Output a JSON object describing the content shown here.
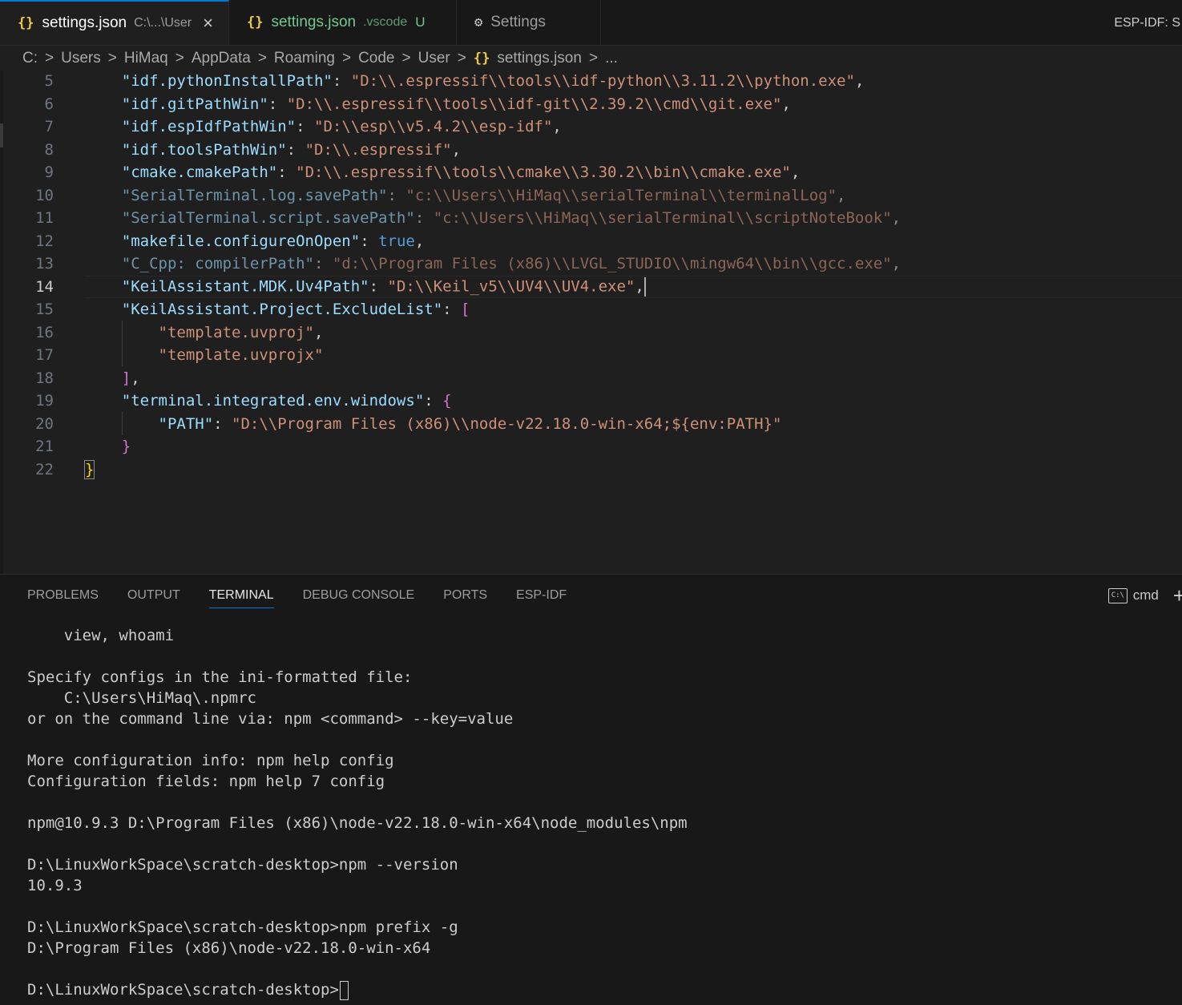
{
  "tabs": [
    {
      "icon": "{}",
      "name": "settings.json",
      "description": "C:\\...\\User",
      "close": "×",
      "badge": ""
    },
    {
      "icon": "{}",
      "name": "settings.json",
      "description": ".vscode",
      "close": "",
      "badge": "U"
    },
    {
      "icon": "⚙",
      "name": "Settings",
      "description": "",
      "close": "",
      "badge": ""
    }
  ],
  "tabbar_right": "ESP-IDF: S",
  "breadcrumb": {
    "items": [
      "C:",
      "Users",
      "HiMaq",
      "AppData",
      "Roaming",
      "Code",
      "User"
    ],
    "file_icon": "{}",
    "file": "settings.json",
    "ellipsis": "...",
    "separator": ">"
  },
  "editor": {
    "current_line": 14,
    "lines": [
      {
        "n": "5",
        "key": "\"idf.pythonInstallPath\"",
        "val": "\"D:\\\\.espressif\\\\tools\\\\idf-python\\\\3.11.2\\\\python.exe\"",
        "tail": ","
      },
      {
        "n": "6",
        "key": "\"idf.gitPathWin\"",
        "val": "\"D:\\\\.espressif\\\\tools\\\\idf-git\\\\2.39.2\\\\cmd\\\\git.exe\"",
        "tail": ","
      },
      {
        "n": "7",
        "key": "\"idf.espIdfPathWin\"",
        "val": "\"D:\\\\esp\\\\v5.4.2\\\\esp-idf\"",
        "tail": ","
      },
      {
        "n": "8",
        "key": "\"idf.toolsPathWin\"",
        "val": "\"D:\\\\.espressif\"",
        "tail": ","
      },
      {
        "n": "9",
        "key": "\"cmake.cmakePath\"",
        "val": "\"D:\\\\.espressif\\\\tools\\\\cmake\\\\3.30.2\\\\bin\\\\cmake.exe\"",
        "tail": ","
      },
      {
        "n": "10",
        "key": "\"SerialTerminal.log.savePath\"",
        "val": "\"c:\\\\Users\\\\HiMaq\\\\serialTerminal\\\\terminalLog\"",
        "tail": ","
      },
      {
        "n": "11",
        "key": "\"SerialTerminal.script.savePath\"",
        "val": "\"c:\\\\Users\\\\HiMaq\\\\serialTerminal\\\\scriptNoteBook\"",
        "tail": ","
      },
      {
        "n": "12",
        "key": "\"makefile.configureOnOpen\"",
        "val": "true",
        "tail": ","
      },
      {
        "n": "13",
        "key": "\"C_Cpp: compilerPath\"",
        "val": "\"d:\\\\Program Files (x86)\\\\LVGL_STUDIO\\\\mingw64\\\\bin\\\\gcc.exe\"",
        "tail": ","
      },
      {
        "n": "14",
        "key": "\"KeilAssistant.MDK.Uv4Path\"",
        "val": "\"D:\\\\Keil_v5\\\\UV4\\\\UV4.exe\"",
        "tail": ","
      },
      {
        "n": "15",
        "key": "\"KeilAssistant.Project.ExcludeList\"",
        "open": "["
      },
      {
        "n": "16",
        "item": "\"template.uvproj\"",
        "tail": ","
      },
      {
        "n": "17",
        "item": "\"template.uvprojx\""
      },
      {
        "n": "18",
        "close": "]",
        "tail": ","
      },
      {
        "n": "19",
        "key": "\"terminal.integrated.env.windows\"",
        "open": "{"
      },
      {
        "n": "20",
        "key": "\"PATH\"",
        "val": "\"D:\\\\Program Files (x86)\\\\node-v22.18.0-win-x64;${env:PATH}\""
      },
      {
        "n": "21",
        "close": "}"
      },
      {
        "n": "22",
        "rootclose": "}"
      }
    ]
  },
  "panel": {
    "tabs": [
      "PROBLEMS",
      "OUTPUT",
      "TERMINAL",
      "DEBUG CONSOLE",
      "PORTS",
      "ESP-IDF"
    ],
    "active_tab": "TERMINAL",
    "terminal_icon_text": "C:\\",
    "terminal_name": "cmd",
    "new_terminal": "+"
  },
  "terminal": {
    "lines": [
      "    view, whoami",
      "",
      "Specify configs in the ini-formatted file:",
      "    C:\\Users\\HiMaq\\.npmrc",
      "or on the command line via: npm <command> --key=value",
      "",
      "More configuration info: npm help config",
      "Configuration fields: npm help 7 config",
      "",
      "npm@10.9.3 D:\\Program Files (x86)\\node-v22.18.0-win-x64\\node_modules\\npm",
      "",
      "D:\\LinuxWorkSpace\\scratch-desktop>npm --version",
      "10.9.3",
      "",
      "D:\\LinuxWorkSpace\\scratch-desktop>npm prefix -g",
      "D:\\Program Files (x86)\\node-v22.18.0-win-x64",
      ""
    ],
    "prompt": "D:\\LinuxWorkSpace\\scratch-desktop>"
  }
}
